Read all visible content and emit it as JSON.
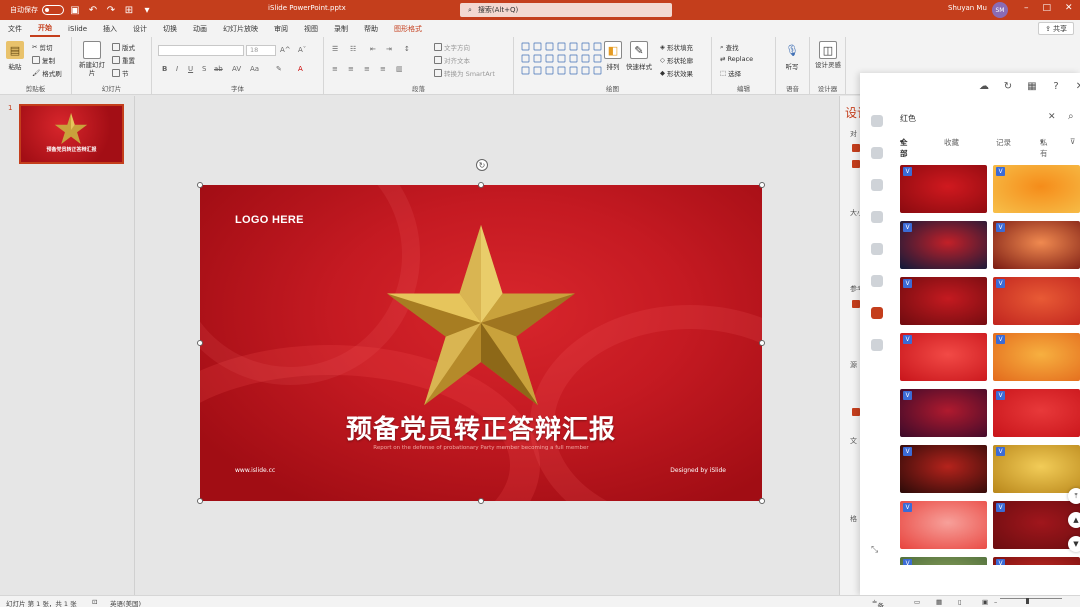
{
  "titlebar": {
    "autosave_label": "自动保存",
    "doc_title": "iSlide PowerPoint.pptx",
    "search_placeholder": "搜索(Alt+Q)",
    "user_name": "Shuyan Mu",
    "user_initials": "SM"
  },
  "menu": {
    "tabs": [
      "文件",
      "开始",
      "iSlide",
      "插入",
      "设计",
      "切换",
      "动画",
      "幻灯片放映",
      "审阅",
      "视图",
      "录制",
      "帮助",
      "图形格式"
    ],
    "active": "开始",
    "share_label": "共享"
  },
  "ribbon": {
    "clipboard": {
      "paste": "粘贴",
      "cut": "剪切",
      "copy": "复制",
      "format_painter": "格式刷",
      "label": "剪贴板"
    },
    "slides": {
      "new_slide": "新建幻灯片",
      "layout": "版式",
      "reset": "重置",
      "section": "节",
      "label": "幻灯片"
    },
    "font": {
      "size_value": "18",
      "label": "字体"
    },
    "paragraph": {
      "text_direction": "文字方向",
      "align_text": "对齐文本",
      "smartart": "转换为 SmartArt",
      "label": "段落"
    },
    "drawing": {
      "arrange": "排列",
      "quick_styles": "快速样式",
      "shape_fill": "形状填充",
      "shape_outline": "形状轮廓",
      "shape_effects": "形状效果",
      "label": "绘图"
    },
    "editing": {
      "find": "查找",
      "replace": "Replace",
      "select": "选择",
      "label": "编辑"
    },
    "voice": {
      "dictate": "听写",
      "label": "语音"
    },
    "designer": {
      "design_ideas": "设计灵感",
      "label": "设计器"
    }
  },
  "thumbnails": {
    "number": "1",
    "title": "预备党员转正答辩汇报"
  },
  "slide": {
    "logo": "LOGO HERE",
    "title": "预备党员转正答辩汇报",
    "subtitle": "Report on the defense of probationary Party member becoming a full member",
    "url": "www.islide.cc",
    "credit": "Designed by iSlide"
  },
  "design_pane": {
    "title": "设计",
    "sections": [
      "对",
      "大小",
      "参考",
      "源",
      "文",
      "格"
    ]
  },
  "islide": {
    "search_query": "红色",
    "filters": [
      "全部",
      "收藏",
      "记录",
      "私有"
    ],
    "vip_badge": "V",
    "tiles": [
      {
        "c1": "#8a0a0f",
        "c2": "#d0191f"
      },
      {
        "c1": "#f7c04a",
        "c2": "#f58c1a"
      },
      {
        "c1": "#0e1a3a",
        "c2": "#c32028"
      },
      {
        "c1": "#7a1a12",
        "c2": "#f08a50"
      },
      {
        "c1": "#6e0b0f",
        "c2": "#c41a20"
      },
      {
        "c1": "#c0241e",
        "c2": "#e85a35"
      },
      {
        "c1": "#c8151b",
        "c2": "#f24a46"
      },
      {
        "c1": "#e36a1c",
        "c2": "#f7b040"
      },
      {
        "c1": "#3a0a2a",
        "c2": "#b01a2e"
      },
      {
        "c1": "#c8141a",
        "c2": "#e8393a"
      },
      {
        "c1": "#2a0a08",
        "c2": "#b5231c"
      },
      {
        "c1": "#b8861a",
        "c2": "#f2cc58"
      },
      {
        "c1": "#e8443e",
        "c2": "#f7a09a"
      },
      {
        "c1": "#6b0d10",
        "c2": "#a0161c"
      },
      {
        "c1": "#4b6b3a",
        "c2": "#8aa05a"
      },
      {
        "c1": "#7a1010",
        "c2": "#c42a24"
      }
    ]
  },
  "statusbar": {
    "slide_info": "幻灯片 第 1 张，共 1 张",
    "language": "英语(美国)",
    "notes": "备注"
  },
  "colors": {
    "accent": "#c43e1c",
    "slide_red": "#c51a22",
    "star_gold": "#c9a23c"
  }
}
